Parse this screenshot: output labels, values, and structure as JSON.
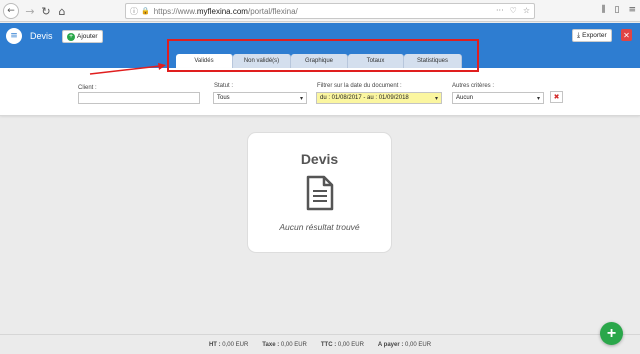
{
  "browser": {
    "url_prefix": "https://www.",
    "url_host": "myflexina.com",
    "url_path": "/portal/flexina/"
  },
  "header": {
    "title": "Devis",
    "add_label": "Ajouter",
    "export_label": "Exporter"
  },
  "tabs": [
    {
      "label": "Validés",
      "active": true
    },
    {
      "label": "Non validé(s)",
      "active": false
    },
    {
      "label": "Graphique",
      "active": false
    },
    {
      "label": "Totaux",
      "active": false
    },
    {
      "label": "Statistiques",
      "active": false
    }
  ],
  "filters": {
    "client_label": "Client :",
    "client_value": "",
    "statut_label": "Statut :",
    "statut_value": "Tous",
    "date_label": "Filtrer sur la date du document :",
    "date_value": "du : 01/08/2017 - au : 01/09/2018",
    "criteria_label": "Autres critères :",
    "criteria_value": "Aucun"
  },
  "empty_state": {
    "title": "Devis",
    "message": "Aucun résultat trouvé"
  },
  "footer": {
    "ht_label": "HT :",
    "ht_value": "0,00 EUR",
    "taxe_label": "Taxe :",
    "taxe_value": "0,00 EUR",
    "ttc_label": "TTC :",
    "ttc_value": "0,00 EUR",
    "apayer_label": "A payer :",
    "apayer_value": "0,00 EUR"
  },
  "colors": {
    "header_blue": "#2e7dd1",
    "highlight_red": "#e01e1e",
    "add_green": "#2aa74a",
    "date_yellow": "#fbf6a0"
  }
}
